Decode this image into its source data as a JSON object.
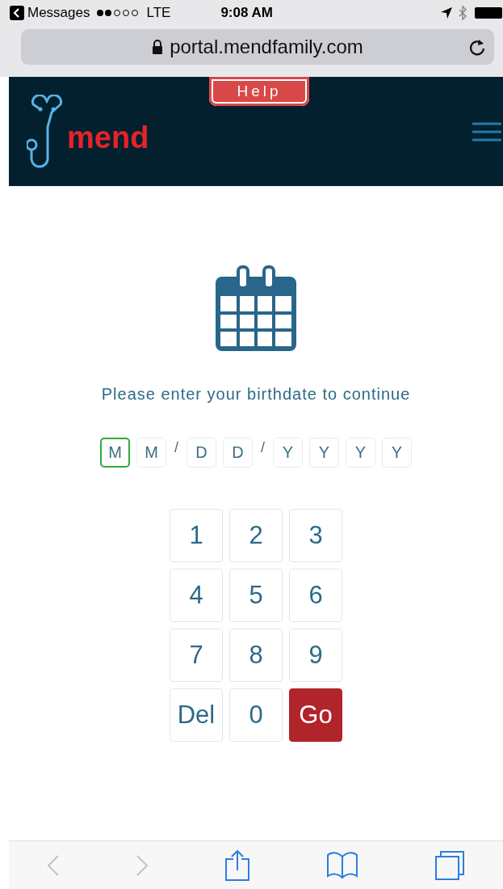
{
  "status_bar": {
    "back_app": "Messages",
    "network": "LTE",
    "time": "9:08 AM"
  },
  "address_bar": {
    "url": "portal.mendfamily.com"
  },
  "header": {
    "help": "Help",
    "logo": "mend"
  },
  "prompt": "Please enter your birthdate to continue",
  "date_fields": [
    {
      "kind": "field",
      "placeholder": "M",
      "selected": true
    },
    {
      "kind": "field",
      "placeholder": "M",
      "selected": false
    },
    {
      "kind": "separator",
      "text": "/"
    },
    {
      "kind": "field",
      "placeholder": "D",
      "selected": false
    },
    {
      "kind": "field",
      "placeholder": "D",
      "selected": false
    },
    {
      "kind": "separator",
      "text": "/"
    },
    {
      "kind": "field",
      "placeholder": "Y",
      "selected": false
    },
    {
      "kind": "field",
      "placeholder": "Y",
      "selected": false
    },
    {
      "kind": "field",
      "placeholder": "Y",
      "selected": false
    },
    {
      "kind": "field",
      "placeholder": "Y",
      "selected": false
    }
  ],
  "keypad": [
    {
      "label": "1",
      "kind": "digit"
    },
    {
      "label": "2",
      "kind": "digit"
    },
    {
      "label": "3",
      "kind": "digit"
    },
    {
      "label": "4",
      "kind": "digit"
    },
    {
      "label": "5",
      "kind": "digit"
    },
    {
      "label": "6",
      "kind": "digit"
    },
    {
      "label": "7",
      "kind": "digit"
    },
    {
      "label": "8",
      "kind": "digit"
    },
    {
      "label": "9",
      "kind": "digit"
    },
    {
      "label": "Del",
      "kind": "delete"
    },
    {
      "label": "0",
      "kind": "digit"
    },
    {
      "label": "Go",
      "kind": "submit"
    }
  ],
  "toolbar": [
    {
      "kind": "back",
      "disabled": true
    },
    {
      "kind": "forward",
      "disabled": true
    },
    {
      "kind": "share",
      "disabled": false
    },
    {
      "kind": "bookmarks",
      "disabled": false
    },
    {
      "kind": "tabs",
      "disabled": false
    }
  ]
}
